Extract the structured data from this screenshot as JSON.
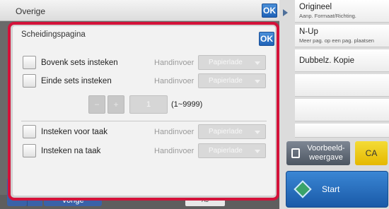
{
  "topbar": {
    "title": "Overige",
    "ok_label": "OK"
  },
  "dialog": {
    "title": "Scheidingspagina",
    "ok_label": "OK",
    "rows": [
      {
        "label": "Bovenk sets insteken",
        "manual": "Handinvoer",
        "tray": "Papierlade"
      },
      {
        "label": "Einde sets insteken",
        "manual": "Handinvoer",
        "tray": "Papierlade"
      },
      {
        "label": "Insteken voor taak",
        "manual": "Handinvoer",
        "tray": "Papierlade"
      },
      {
        "label": "Insteken na taak",
        "manual": "Handinvoer",
        "tray": "Papierlade"
      }
    ],
    "count": {
      "minus": "−",
      "plus": "+",
      "value": "1",
      "range": "(1~9999)"
    }
  },
  "right_panel": {
    "items": [
      {
        "title": "Origineel",
        "subtitle": "Aanp. Formaat/Richting."
      },
      {
        "title": "N-Up",
        "subtitle": "Meer pag. op een pag. plaatsen"
      },
      {
        "title": "Dubbelz. Kopie",
        "subtitle": ""
      }
    ],
    "preview_label": "Voorbeeld-\nweergave",
    "ca_label": "CA",
    "start_label": "Start"
  },
  "bottom": {
    "prev_label": "Vorige",
    "paper_label": "A3",
    "star": "★"
  },
  "colors": {
    "accent": "#1f62b8",
    "highlight_frame": "#d4123a",
    "ca": "#f0c800"
  }
}
